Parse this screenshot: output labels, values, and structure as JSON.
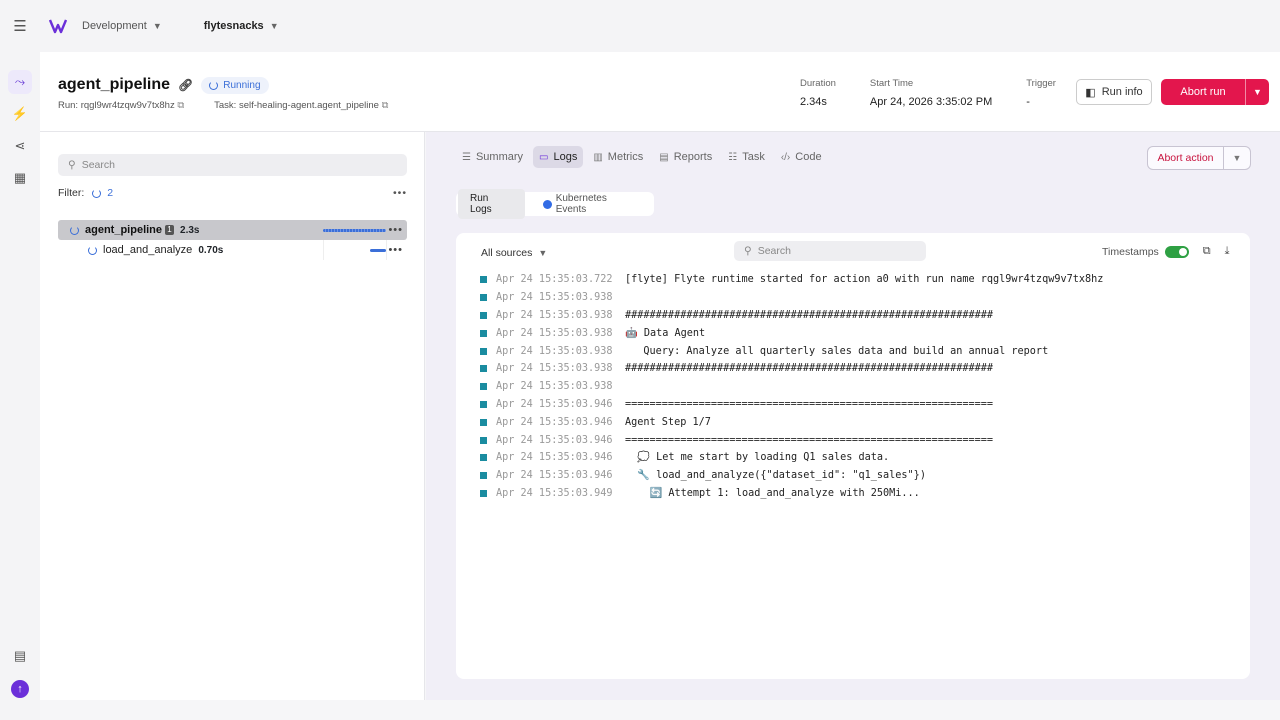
{
  "topbar": {
    "project": "Development",
    "domain": "flytesnacks"
  },
  "rail": {
    "icons": [
      "runs-icon",
      "triggers-icon",
      "share-icon",
      "apps-icon"
    ],
    "bottom_icons": [
      "docs-icon",
      "upgrade-icon"
    ]
  },
  "header": {
    "title": "agent_pipeline",
    "status": "Running",
    "run_label": "Run: rqgl9wr4tzqw9v7tx8hz",
    "task_label": "Task: self-healing-agent.agent_pipeline",
    "duration_label": "Duration",
    "duration_value": "2.34s",
    "start_label": "Start Time",
    "start_value": "Apr 24, 2026 3:35:02 PM",
    "trigger_label": "Trigger",
    "trigger_value": "-",
    "run_info_button": "Run info",
    "abort_run_button": "Abort run"
  },
  "leftpanel": {
    "search_placeholder": "Search",
    "filter_label": "Filter:",
    "filter_count": "2",
    "tree": [
      {
        "name": "agent_pipeline",
        "badge": "1",
        "duration": "2.3s",
        "bar_fraction": 0.95
      },
      {
        "name": "load_and_analyze",
        "duration": "0.70s",
        "bar_fraction": 0.25
      }
    ]
  },
  "rightpanel": {
    "tabs": [
      "Summary",
      "Logs",
      "Metrics",
      "Reports",
      "Task",
      "Code"
    ],
    "active_tab": "Logs",
    "abort_action_button": "Abort action",
    "subtabs": [
      "Run Logs",
      "Kubernetes Events"
    ],
    "sources_label": "All sources",
    "log_search_placeholder": "Search",
    "timestamps_label": "Timestamps",
    "timestamps_on": true,
    "colors": {
      "accent": "#6b2fd9",
      "danger": "#e3164d",
      "log_marker": "#1a8ca0"
    },
    "logs": [
      {
        "ts": "Apr 24 15:35:03.722",
        "msg": "[flyte] Flyte runtime started for action a0 with run name rqgl9wr4tzqw9v7tx8hz"
      },
      {
        "ts": "Apr 24 15:35:03.938",
        "msg": ""
      },
      {
        "ts": "Apr 24 15:35:03.938",
        "msg": "############################################################"
      },
      {
        "ts": "Apr 24 15:35:03.938",
        "msg": "🤖 Data Agent"
      },
      {
        "ts": "Apr 24 15:35:03.938",
        "msg": "   Query: Analyze all quarterly sales data and build an annual report"
      },
      {
        "ts": "Apr 24 15:35:03.938",
        "msg": "############################################################"
      },
      {
        "ts": "Apr 24 15:35:03.938",
        "msg": ""
      },
      {
        "ts": "Apr 24 15:35:03.946",
        "msg": "============================================================"
      },
      {
        "ts": "Apr 24 15:35:03.946",
        "msg": "Agent Step 1/7"
      },
      {
        "ts": "Apr 24 15:35:03.946",
        "msg": "============================================================"
      },
      {
        "ts": "Apr 24 15:35:03.946",
        "msg": "  💭 Let me start by loading Q1 sales data."
      },
      {
        "ts": "Apr 24 15:35:03.946",
        "msg": "  🔧 load_and_analyze({\"dataset_id\": \"q1_sales\"})"
      },
      {
        "ts": "Apr 24 15:35:03.949",
        "msg": "    🔄 Attempt 1: load_and_analyze with 250Mi..."
      }
    ]
  }
}
